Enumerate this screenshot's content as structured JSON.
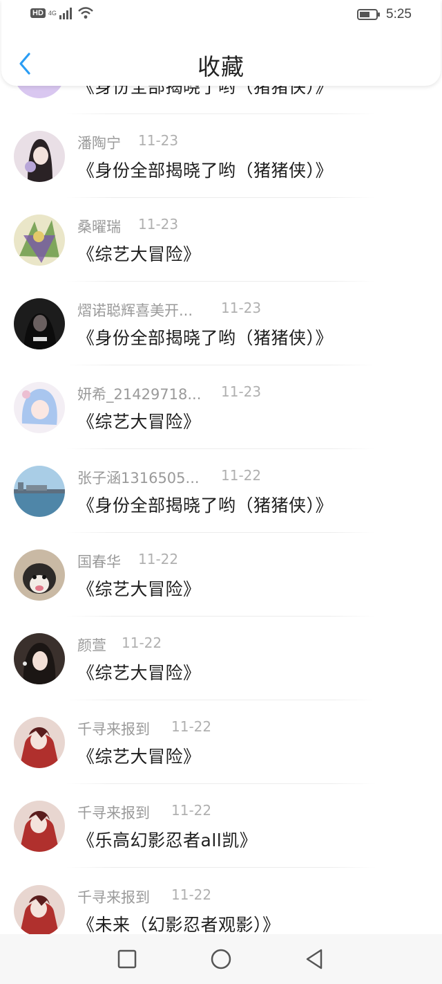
{
  "status": {
    "hd": "HD",
    "network": "4G",
    "time": "5:25"
  },
  "header": {
    "title": "收藏"
  },
  "items": [
    {
      "name": "",
      "date": "",
      "title": "《身份全部揭晓了哟（猪猪侠）》"
    },
    {
      "name": "潘陶宁",
      "date": "11-23",
      "title": "《身份全部揭晓了哟（猪猪侠）》"
    },
    {
      "name": "桑曜瑞",
      "date": "11-23",
      "title": "《综艺大冒险》"
    },
    {
      "name": "熠诺聪辉喜美开...",
      "date": "11-23",
      "title": "《身份全部揭晓了哟（猪猪侠）》"
    },
    {
      "name": "妍希_21429718...",
      "date": "11-23",
      "title": "《综艺大冒险》"
    },
    {
      "name": "张子涵1316505...",
      "date": "11-22",
      "title": "《身份全部揭晓了哟（猪猪侠）》"
    },
    {
      "name": "国春华",
      "date": "11-22",
      "title": "《综艺大冒险》"
    },
    {
      "name": "颜萱",
      "date": "11-22",
      "title": "《综艺大冒险》"
    },
    {
      "name": "千寻来报到",
      "date": "11-22",
      "title": "《综艺大冒险》"
    },
    {
      "name": "千寻来报到",
      "date": "11-22",
      "title": "《乐高幻影忍者all凯》"
    },
    {
      "name": "千寻来报到",
      "date": "11-22",
      "title": "《未来（幻影忍者观影）》"
    }
  ],
  "icons": {
    "back": "chevron-left-icon",
    "recent": "square-icon",
    "home": "circle-icon",
    "back_nav": "triangle-back-icon"
  },
  "colors": {
    "accent": "#2a9df4",
    "name_text": "#9a9a9a",
    "date_text": "#b0b0b0",
    "title_text": "#1e1e1e"
  }
}
